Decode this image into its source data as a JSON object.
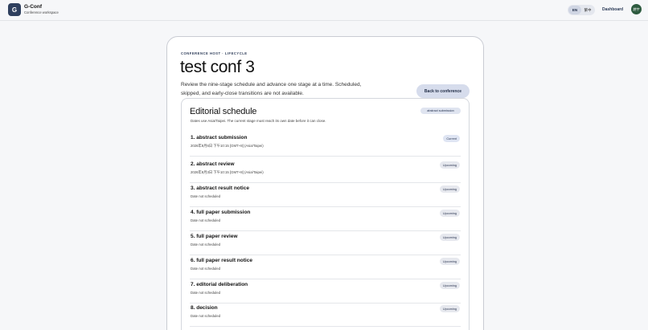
{
  "header": {
    "logo_letter": "G",
    "brand_name": "G-Conf",
    "brand_sub": "Conference workspace",
    "lang_en": "EN",
    "lang_zh": "繁中",
    "dashboard_label": "Dashboard",
    "avatar_text": "趙宇"
  },
  "page": {
    "eyebrow": "CONFERENCE HOST · LIFECYCLE",
    "title": "test conf 3",
    "description": "Review the nine-stage schedule and advance one stage at a time. Scheduled, skipped, and early-close transitions are not available.",
    "back_label": "Back to conference"
  },
  "schedule": {
    "title": "Editorial schedule",
    "subtitle": "Dates use Asia/Taipei. The current stage must reach its own date before it can close.",
    "current_stage_badge": "abstract submission",
    "stages": [
      {
        "name": "1. abstract submission",
        "date": "2026年8月6日 下午10:15 [GMT+8] (Asia/Taipei)",
        "status": "Current"
      },
      {
        "name": "2. abstract review",
        "date": "2026年8月3日 下午10:15 [GMT+8] (Asia/Taipei)",
        "status": "Upcoming"
      },
      {
        "name": "3. abstract result notice",
        "date": "Date not scheduled",
        "status": "Upcoming"
      },
      {
        "name": "4. full paper submission",
        "date": "Date not scheduled",
        "status": "Upcoming"
      },
      {
        "name": "5. full paper review",
        "date": "Date not scheduled",
        "status": "Upcoming"
      },
      {
        "name": "6. full paper result notice",
        "date": "Date not scheduled",
        "status": "Upcoming"
      },
      {
        "name": "7. editorial deliberation",
        "date": "Date not scheduled",
        "status": "Upcoming"
      },
      {
        "name": "8. decision",
        "date": "Date not scheduled",
        "status": "Upcoming"
      }
    ]
  }
}
